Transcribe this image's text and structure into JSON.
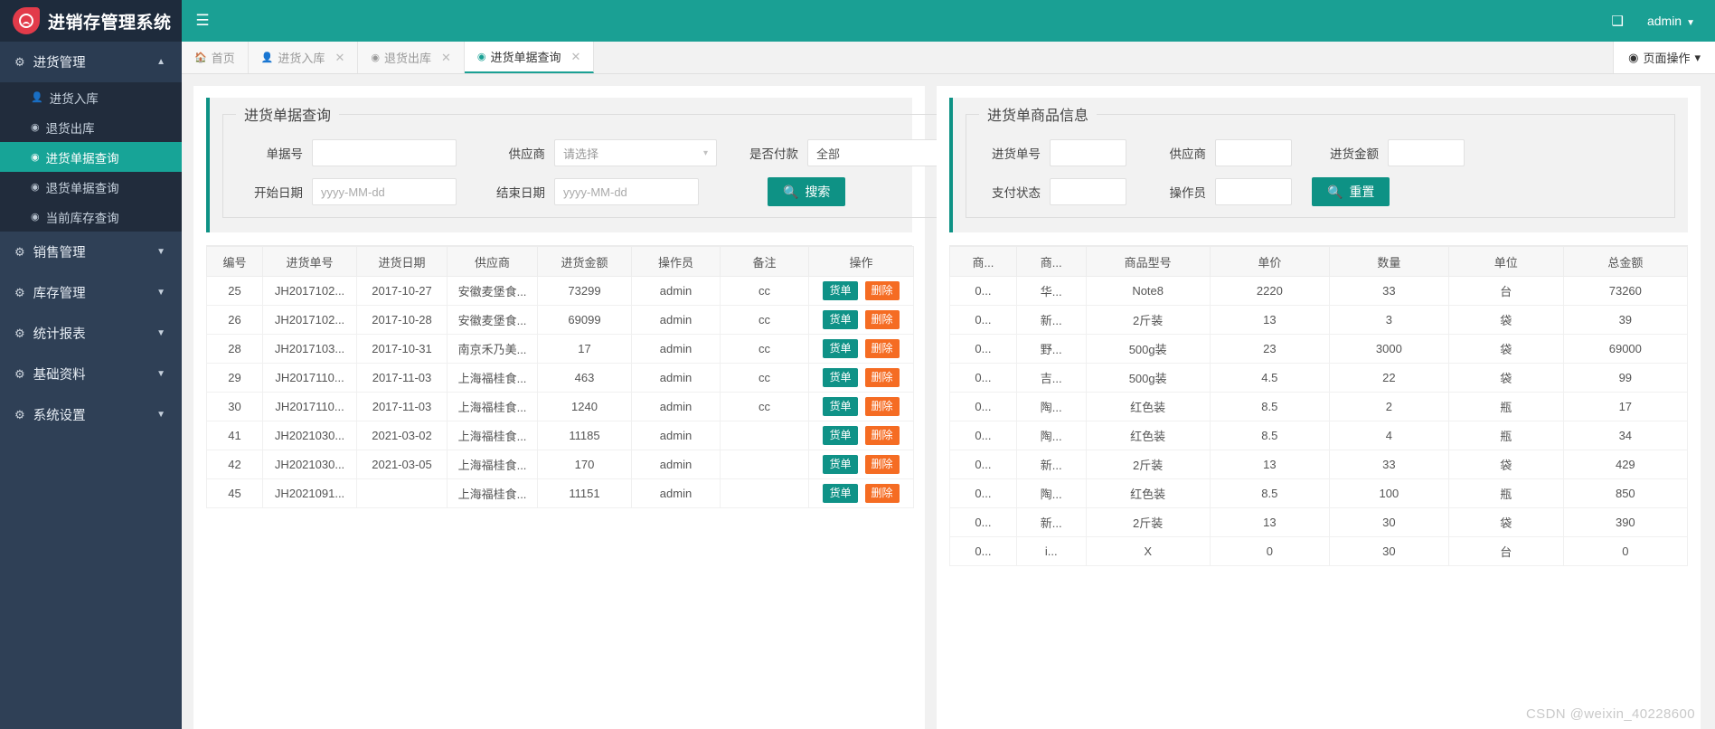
{
  "brand": {
    "title": "进销存管理系统",
    "logo_icon": "record-blob-icon"
  },
  "topbar": {
    "collapse_icon": "menu-collapse-icon",
    "fullscreen_icon": "fullscreen-icon",
    "user": "admin",
    "user_caret": "▼",
    "accent": "#1aa094"
  },
  "sidebar": {
    "groups": [
      {
        "label": "进货管理",
        "icon": "gears-icon",
        "caret": "▲",
        "open": true,
        "items": [
          {
            "label": "进货入库",
            "icon": "user-icon",
            "active": false
          },
          {
            "label": "退货出库",
            "icon": "dashboard-icon",
            "active": false
          },
          {
            "label": "进货单据查询",
            "icon": "dashboard-icon",
            "active": true
          },
          {
            "label": "退货单据查询",
            "icon": "dashboard-icon",
            "active": false
          },
          {
            "label": "当前库存查询",
            "icon": "dashboard-icon",
            "active": false
          }
        ]
      },
      {
        "label": "销售管理",
        "icon": "gears-icon",
        "caret": "▼",
        "open": false,
        "items": []
      },
      {
        "label": "库存管理",
        "icon": "gears-icon",
        "caret": "▼",
        "open": false,
        "items": []
      },
      {
        "label": "统计报表",
        "icon": "gears-icon",
        "caret": "▼",
        "open": false,
        "items": []
      },
      {
        "label": "基础资料",
        "icon": "gears-icon",
        "caret": "▼",
        "open": false,
        "items": []
      },
      {
        "label": "系统设置",
        "icon": "gears-icon",
        "caret": "▼",
        "open": false,
        "items": []
      }
    ]
  },
  "tabs": {
    "items": [
      {
        "label": "首页",
        "icon": "home-icon",
        "closable": false,
        "active": false
      },
      {
        "label": "进货入库",
        "icon": "user-icon",
        "closable": true,
        "active": false
      },
      {
        "label": "退货出库",
        "icon": "dashboard-icon",
        "closable": true,
        "active": false
      },
      {
        "label": "进货单据查询",
        "icon": "dashboard-icon",
        "closable": true,
        "active": true
      }
    ],
    "close_glyph": "✕",
    "page_ops": {
      "label": "页面操作",
      "icon": "target-icon",
      "caret": "▾"
    }
  },
  "left_panel": {
    "legend": "进货单据查询",
    "fields": {
      "order_no": {
        "label": "单据号",
        "value": "",
        "placeholder": ""
      },
      "supplier": {
        "label": "供应商",
        "value": "请选择",
        "caret": "▾"
      },
      "paid": {
        "label": "是否付款",
        "value": "全部",
        "caret": "▾"
      },
      "start_date": {
        "label": "开始日期",
        "value": "",
        "placeholder": "yyyy-MM-dd"
      },
      "end_date": {
        "label": "结束日期",
        "value": "",
        "placeholder": "yyyy-MM-dd"
      }
    },
    "search_button": {
      "label": "搜索",
      "icon": "search-icon"
    },
    "table": {
      "columns": [
        "编号",
        "进货单号",
        "进货日期",
        "供应商",
        "进货金额",
        "操作员",
        "备注",
        "操作"
      ],
      "rows": [
        {
          "id": "25",
          "order_no": "JH2017102...",
          "date": "2017-10-27",
          "supplier": "安徽麦堡食...",
          "amount": "73299",
          "operator": "admin",
          "remark": "cc"
        },
        {
          "id": "26",
          "order_no": "JH2017102...",
          "date": "2017-10-28",
          "supplier": "安徽麦堡食...",
          "amount": "69099",
          "operator": "admin",
          "remark": "cc"
        },
        {
          "id": "28",
          "order_no": "JH2017103...",
          "date": "2017-10-31",
          "supplier": "南京禾乃美...",
          "amount": "17",
          "operator": "admin",
          "remark": "cc"
        },
        {
          "id": "29",
          "order_no": "JH2017110...",
          "date": "2017-11-03",
          "supplier": "上海福桂食...",
          "amount": "463",
          "operator": "admin",
          "remark": "cc"
        },
        {
          "id": "30",
          "order_no": "JH2017110...",
          "date": "2017-11-03",
          "supplier": "上海福桂食...",
          "amount": "1240",
          "operator": "admin",
          "remark": "cc"
        },
        {
          "id": "41",
          "order_no": "JH2021030...",
          "date": "2021-03-02",
          "supplier": "上海福桂食...",
          "amount": "11185",
          "operator": "admin",
          "remark": ""
        },
        {
          "id": "42",
          "order_no": "JH2021030...",
          "date": "2021-03-05",
          "supplier": "上海福桂食...",
          "amount": "170",
          "operator": "admin",
          "remark": ""
        },
        {
          "id": "45",
          "order_no": "JH2021091...",
          "date": "",
          "supplier": "上海福桂食...",
          "amount": "11151",
          "operator": "admin",
          "remark": ""
        }
      ],
      "row_actions": {
        "detail": "货单",
        "delete": "删除"
      }
    }
  },
  "right_panel": {
    "legend": "进货单商品信息",
    "fields": {
      "order_no": {
        "label": "进货单号",
        "value": ""
      },
      "supplier": {
        "label": "供应商",
        "value": ""
      },
      "amount": {
        "label": "进货金额",
        "value": ""
      },
      "pay_status": {
        "label": "支付状态",
        "value": ""
      },
      "operator": {
        "label": "操作员",
        "value": ""
      }
    },
    "reset_button": {
      "label": "重置",
      "icon": "search-icon"
    },
    "table": {
      "columns": [
        "商...",
        "商...",
        "商品型号",
        "单价",
        "数量",
        "单位",
        "总金额"
      ],
      "rows": [
        {
          "c0": "0...",
          "c1": "华...",
          "model": "Note8",
          "price": "2220",
          "qty": "33",
          "unit": "台",
          "total": "73260"
        },
        {
          "c0": "0...",
          "c1": "新...",
          "model": "2斤装",
          "price": "13",
          "qty": "3",
          "unit": "袋",
          "total": "39"
        },
        {
          "c0": "0...",
          "c1": "野...",
          "model": "500g装",
          "price": "23",
          "qty": "3000",
          "unit": "袋",
          "total": "69000"
        },
        {
          "c0": "0...",
          "c1": "吉...",
          "model": "500g装",
          "price": "4.5",
          "qty": "22",
          "unit": "袋",
          "total": "99"
        },
        {
          "c0": "0...",
          "c1": "陶...",
          "model": "红色装",
          "price": "8.5",
          "qty": "2",
          "unit": "瓶",
          "total": "17"
        },
        {
          "c0": "0...",
          "c1": "陶...",
          "model": "红色装",
          "price": "8.5",
          "qty": "4",
          "unit": "瓶",
          "total": "34"
        },
        {
          "c0": "0...",
          "c1": "新...",
          "model": "2斤装",
          "price": "13",
          "qty": "33",
          "unit": "袋",
          "total": "429"
        },
        {
          "c0": "0...",
          "c1": "陶...",
          "model": "红色装",
          "price": "8.5",
          "qty": "100",
          "unit": "瓶",
          "total": "850"
        },
        {
          "c0": "0...",
          "c1": "新...",
          "model": "2斤装",
          "price": "13",
          "qty": "30",
          "unit": "袋",
          "total": "390"
        },
        {
          "c0": "0...",
          "c1": "i...",
          "model": "X",
          "price": "0",
          "qty": "30",
          "unit": "台",
          "total": "0"
        }
      ]
    }
  },
  "watermark": "CSDN @weixin_40228600"
}
